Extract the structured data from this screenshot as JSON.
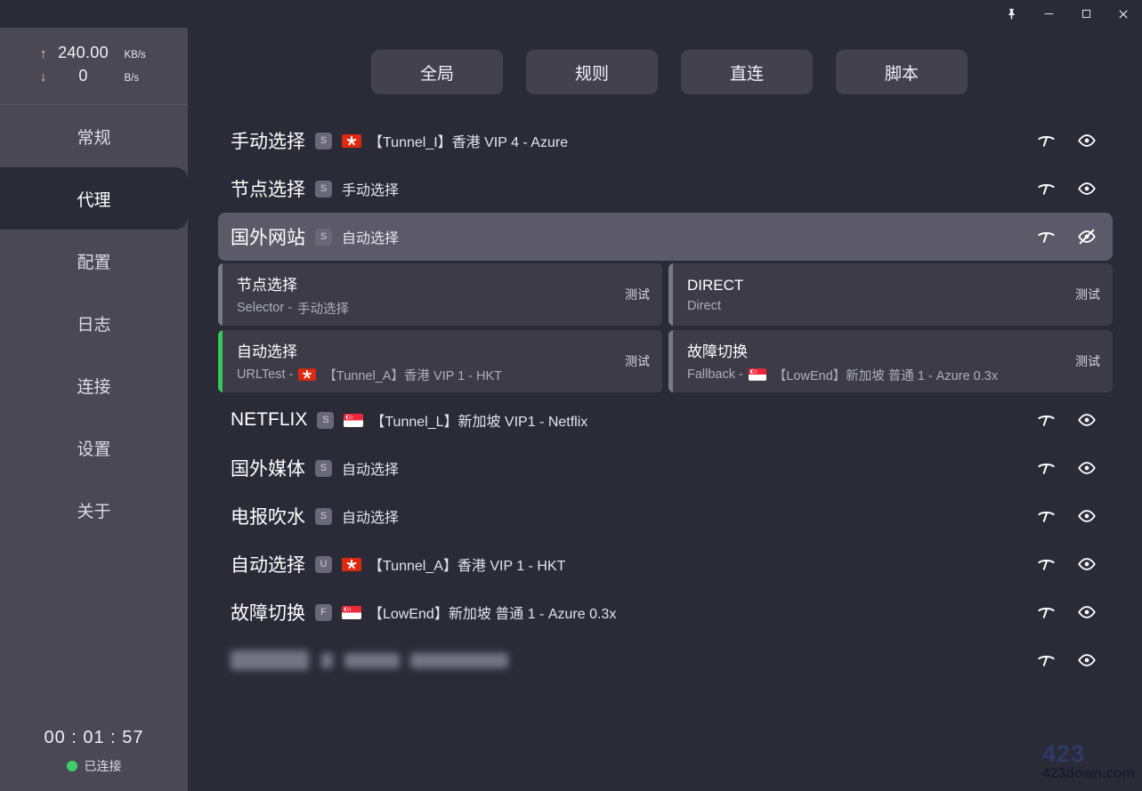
{
  "titlebar": {
    "buttons": [
      {
        "name": "pin",
        "label": "Pin"
      },
      {
        "name": "minimize",
        "label": "Minimize"
      },
      {
        "name": "maximize",
        "label": "Maximize"
      },
      {
        "name": "close",
        "label": "Close"
      }
    ]
  },
  "sidebar": {
    "speed": {
      "up": {
        "arrow": "↑",
        "value": "240.00",
        "unit": "KB/s"
      },
      "down": {
        "arrow": "↓",
        "value": "0",
        "unit": "B/s"
      }
    },
    "items": [
      {
        "label": "常规",
        "name": "general",
        "active": false
      },
      {
        "label": "代理",
        "name": "proxy",
        "active": true
      },
      {
        "label": "配置",
        "name": "profiles",
        "active": false
      },
      {
        "label": "日志",
        "name": "logs",
        "active": false
      },
      {
        "label": "连接",
        "name": "connections",
        "active": false
      },
      {
        "label": "设置",
        "name": "settings",
        "active": false
      },
      {
        "label": "关于",
        "name": "about",
        "active": false
      }
    ],
    "footer": {
      "timer": "00 : 01 : 57",
      "status": "已连接",
      "status_color": "#3ecf6d"
    }
  },
  "modes": [
    {
      "label": "全局",
      "name": "global"
    },
    {
      "label": "规则",
      "name": "rule"
    },
    {
      "label": "直连",
      "name": "direct"
    },
    {
      "label": "脚本",
      "name": "script"
    }
  ],
  "groups": [
    {
      "name": "手动选择",
      "type_badge": "S",
      "flag": "hk",
      "selection": "【Tunnel_I】香港 VIP 4 - Azure",
      "expanded": false,
      "visible": true
    },
    {
      "name": "节点选择",
      "type_badge": "S",
      "flag": "",
      "selection": "手动选择",
      "expanded": false,
      "visible": true
    },
    {
      "name": "国外网站",
      "type_badge": "S",
      "flag": "",
      "selection": "自动选择",
      "expanded": true,
      "visible": false,
      "nodes": [
        {
          "title": "节点选择",
          "subtitle_prefix": "Selector - ",
          "flag": "",
          "subtitle": "手动选择",
          "test_label": "测试",
          "active": false
        },
        {
          "title": "DIRECT",
          "subtitle_prefix": "Direct",
          "flag": "",
          "subtitle": "",
          "test_label": "测试",
          "active": false
        },
        {
          "title": "自动选择",
          "subtitle_prefix": "URLTest - ",
          "flag": "hk",
          "subtitle": "【Tunnel_A】香港 VIP 1 - HKT",
          "test_label": "测试",
          "active": true
        },
        {
          "title": "故障切换",
          "subtitle_prefix": "Fallback - ",
          "flag": "sg",
          "subtitle": "【LowEnd】新加坡 普通 1 - Azure 0.3x",
          "test_label": "测试",
          "active": false
        }
      ]
    },
    {
      "name": "NETFLIX",
      "type_badge": "S",
      "flag": "sg",
      "selection": "【Tunnel_L】新加坡 VIP1 - Netflix",
      "expanded": false,
      "visible": true
    },
    {
      "name": "国外媒体",
      "type_badge": "S",
      "flag": "",
      "selection": "自动选择",
      "expanded": false,
      "visible": true
    },
    {
      "name": "电报吹水",
      "type_badge": "S",
      "flag": "",
      "selection": "自动选择",
      "expanded": false,
      "visible": true
    },
    {
      "name": "自动选择",
      "type_badge": "U",
      "flag": "hk",
      "selection": "【Tunnel_A】香港 VIP 1 - HKT",
      "expanded": false,
      "visible": true
    },
    {
      "name": "故障切换",
      "type_badge": "F",
      "flag": "sg",
      "selection": "【LowEnd】新加坡 普通 1 - Azure 0.3x",
      "expanded": false,
      "visible": true
    },
    {
      "name": "",
      "type_badge": "",
      "flag": "",
      "selection": "",
      "expanded": false,
      "visible": true,
      "redacted": true
    }
  ],
  "watermark": {
    "top": "423",
    "bottom": "423down.com"
  },
  "colors": {
    "background": "#2b2b38",
    "sidebar": "#4a4854",
    "row_highlight": "#5c5a68",
    "card": "#3d3b48",
    "accent_green": "#35c759",
    "mode_button": "#43414e"
  }
}
